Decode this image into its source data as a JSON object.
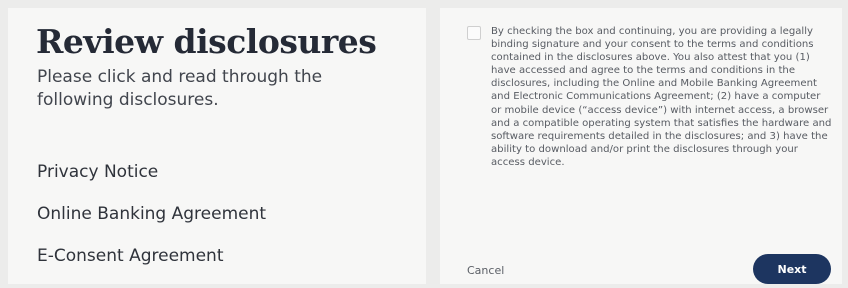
{
  "review": {
    "title": "Review disclosures",
    "subtitle": "Please click and read through the following disclosures.",
    "disclosures": [
      "Privacy Notice",
      "Online Banking Agreement",
      "E-Consent Agreement"
    ]
  },
  "consent": {
    "checked": false,
    "text": "By checking the box and continuing, you are providing a legally binding signature and your consent to the terms and conditions contained in the disclosures above. You also attest that you (1) have accessed and agree to the terms and conditions in the disclosures, including the Online and Mobile Banking Agreement and Electronic Communications Agreement; (2) have a computer or mobile device (“access device”) with internet access, a browser and a compatible operating system that satisfies the hardware and software requirements detailed in the disclosures; and 3) have the ability to download and/or print the disclosures through your access device."
  },
  "actions": {
    "cancel_label": "Cancel",
    "next_label": "Next"
  },
  "colors": {
    "next_button": "#1d3560",
    "heading": "#252a36"
  }
}
